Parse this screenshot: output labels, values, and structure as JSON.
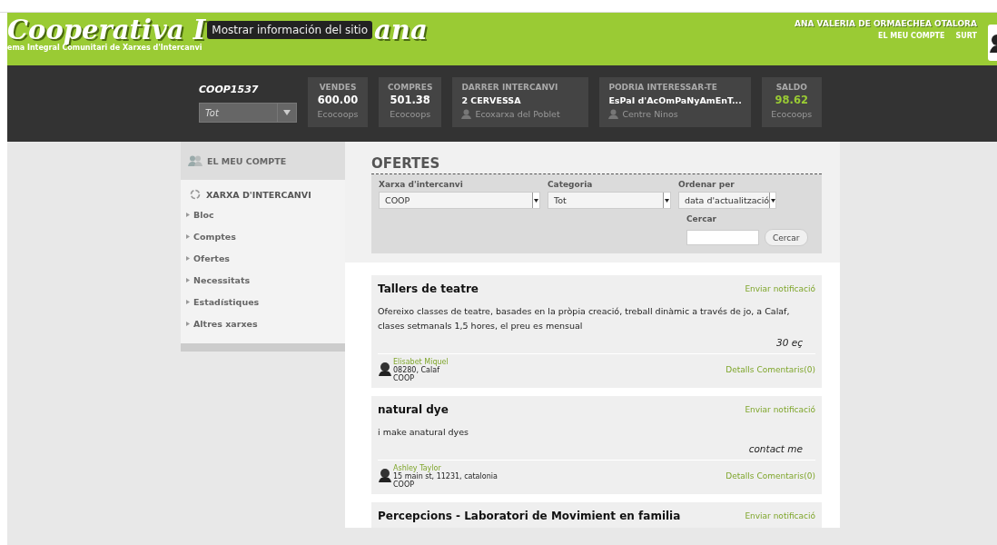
{
  "header": {
    "logo_parts": [
      "Cooperativa I",
      "ana"
    ],
    "tooltip": "Mostrar información del sitio",
    "subtitle": "ema Integral Comunitari de Xarxes d'Intercanvi",
    "user_name": "ANA VALERIA DE ORMAECHEA OTALORA",
    "user_links": [
      "EL MEU COMPTE",
      "SURT"
    ]
  },
  "account_bar": {
    "account": "COOP1537",
    "account_select": "Tot",
    "stats": [
      {
        "kind": "number",
        "label": "VENDES",
        "value": "600.00",
        "sub": "Ecocoops"
      },
      {
        "kind": "number",
        "label": "COMPRES",
        "value": "501.38",
        "sub": "Ecocoops"
      },
      {
        "kind": "person",
        "label": "DARRER INTERCANVI",
        "value": "2 CERVESSA",
        "sub": "Ecoxarxa del Poblet"
      },
      {
        "kind": "person",
        "label": "PODRIA INTERESSAR-TE",
        "value": "EsPaI d'AcOmPaNyAmEnT...",
        "sub": "Centre Ninos"
      },
      {
        "kind": "highlight",
        "label": "SALDO",
        "value": "98.62",
        "sub": "Ecocoops"
      }
    ]
  },
  "sidebar": {
    "account_heading": "EL MEU COMPTE",
    "section_heading": "XARXA D'INTERCANVI",
    "items": [
      "Bloc",
      "Comptes",
      "Ofertes",
      "Necessitats",
      "Estadístiques",
      "Altres xarxes"
    ]
  },
  "offers": {
    "title": "OFERTES",
    "filters": [
      {
        "label": "Xarxa d'intercanvi",
        "value": "COOP"
      },
      {
        "label": "Categoria",
        "value": "Tot"
      },
      {
        "label": "Ordenar per",
        "value": "data d'actualització"
      }
    ],
    "search_label": "Cercar",
    "search_button": "Cercar",
    "items": [
      {
        "title": "Tallers de teatre",
        "notify": "Enviar notificació",
        "description": "Ofereixo classes de teatre, basades en la pròpia creació, treball dinàmic a través de jo, a Calaf, clases setmanals 1,5 hores, el preu es mensual",
        "price": "30 eç",
        "author": "Elisabet Miquel",
        "location": "08280, Calaf",
        "network": "COOP",
        "links": [
          "Detalls",
          "Comentaris(0)"
        ]
      },
      {
        "title": "natural dye",
        "notify": "Enviar notificació",
        "description": "i make anatural dyes",
        "price": "contact me",
        "author": "Ashley Taylor",
        "location": "15 main st, 11231, catalonia",
        "network": "COOP",
        "links": [
          "Detalls",
          "Comentaris(0)"
        ]
      },
      {
        "title": "Percepcions - Laboratori de Movimient en familia",
        "notify": "Enviar notificació"
      }
    ]
  }
}
